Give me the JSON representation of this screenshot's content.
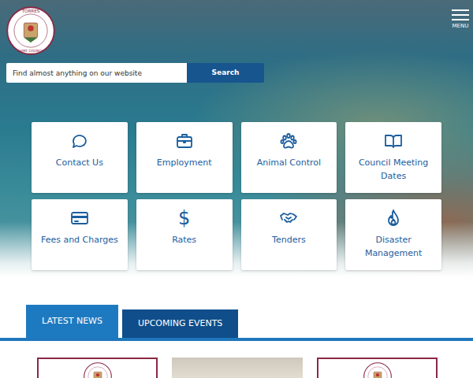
{
  "logo": {
    "top": "TORRES",
    "bottom": "SHIRE COUNCIL"
  },
  "menu": {
    "label": "MENU"
  },
  "search": {
    "placeholder": "Find almost anything on our website",
    "button": "Search"
  },
  "tiles": [
    {
      "label": "Contact Us"
    },
    {
      "label": "Employment"
    },
    {
      "label": "Animal Control"
    },
    {
      "label": "Council Meeting Dates"
    },
    {
      "label": "Fees and Charges"
    },
    {
      "label": "Rates",
      "icon_text": "$"
    },
    {
      "label": "Tenders"
    },
    {
      "label": "Disaster Management"
    }
  ],
  "tabs": [
    {
      "label": "LATEST NEWS",
      "selected": true
    },
    {
      "label": "UPCOMING EVENTS",
      "selected": false
    }
  ],
  "news": [
    {
      "kind": "logo"
    },
    {
      "kind": "photo"
    },
    {
      "kind": "logo"
    }
  ]
}
